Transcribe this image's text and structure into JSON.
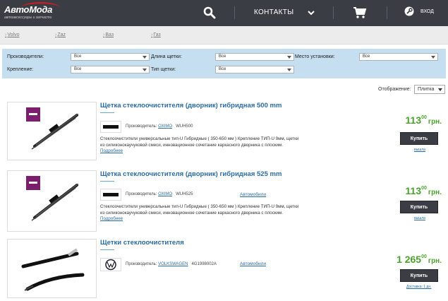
{
  "header": {
    "logo_text": "АвтоМода",
    "logo_subtitle": "автоаксессуары и запчасти",
    "ghost_left": "",
    "ghost_right": "",
    "contacts_label": "КОНТАКТЫ",
    "login_label": "ВХОД"
  },
  "brands": [
    "Volvo",
    "Zaz",
    "Ваз",
    "Газ"
  ],
  "filters": {
    "manufacturers_label": "Производители:",
    "manufacturers_value": "Все",
    "length_label": "Длина щетки:",
    "length_value": "Все",
    "place_label": "Место установки:",
    "place_value": "Все",
    "mount_label": "Крепление:",
    "mount_value": "Все",
    "type_label": "Тип щетки:",
    "type_value": "Все"
  },
  "display": {
    "label": "Отображение:",
    "value": "Плитка"
  },
  "products": [
    {
      "title": "Щетка стеклоочистителя (дворник) гибридная 500 mm",
      "mfr_label": "Производитель:",
      "mfr_name": "OXIMO",
      "sku": "WUH500",
      "category": "",
      "description": "Стеклоочистители универсальные тип-U Гибридные ( 350-650 мм ) Крепление ТИП-U 9мм, щетки из силиконокаучуковой смеси, инновационное сочетание каркасного дворника с плоским.",
      "more_label": "Подробнее",
      "price_int": "113",
      "price_frac": "00",
      "currency": "грн.",
      "buy_label": "Купить",
      "stock": "вышла"
    },
    {
      "title": "Щетка стеклоочистителя (дворник) гибридная 525 mm",
      "mfr_label": "Производитель:",
      "mfr_name": "OXIMO",
      "sku": "WUH525",
      "category": "Автомобили",
      "description": "Стеклоочистители универсальные тип-U Гибридные ( 350-650 мм ) Крепление ТИП-U 9мм, щетки из силиконокаучуковой смеси, инновационное сочетание каркасного дворника с плоским.",
      "more_label": "Подробнее",
      "price_int": "113",
      "price_frac": "00",
      "currency": "грн.",
      "buy_label": "Купить",
      "stock": "вышла"
    },
    {
      "title": "Щетки стеклоочистителя",
      "mfr_label": "Производитель:",
      "mfr_name": "VOLKSWAGEN",
      "sku": "4G1998002A",
      "category": "Автомобили",
      "description": "",
      "more_label": "",
      "price_int": "1 265",
      "price_frac": "00",
      "currency": "грн.",
      "buy_label": "Купить",
      "stock": "Доставка: 1 дн."
    }
  ],
  "colors": {
    "topbar": "#3a3d44",
    "accent_red": "#d71920",
    "link_blue": "#2a6ca6",
    "price_green": "#4aa22d",
    "filter_bg": "#c6dff0"
  },
  "icons": [
    "search-icon",
    "chevron-down-icon",
    "cart-icon",
    "wrench-icon"
  ]
}
